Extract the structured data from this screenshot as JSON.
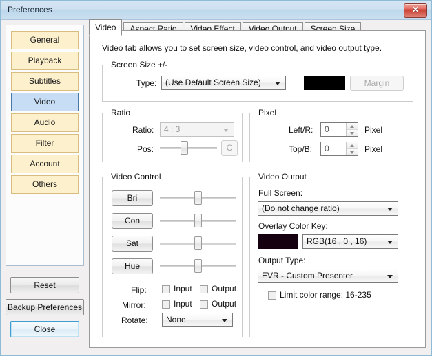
{
  "window": {
    "title": "Preferences",
    "close_label": "✕"
  },
  "sidebar": {
    "items": [
      {
        "label": "General",
        "selected": false
      },
      {
        "label": "Playback",
        "selected": false
      },
      {
        "label": "Subtitles",
        "selected": false
      },
      {
        "label": "Video",
        "selected": true
      },
      {
        "label": "Audio",
        "selected": false
      },
      {
        "label": "Filter",
        "selected": false
      },
      {
        "label": "Account",
        "selected": false
      },
      {
        "label": "Others",
        "selected": false
      }
    ],
    "actions": [
      {
        "label": "Reset"
      },
      {
        "label": "Backup Preferences"
      },
      {
        "label": "Close"
      }
    ]
  },
  "tabs": [
    {
      "label": "Video",
      "active": true
    },
    {
      "label": "Aspect Ratio",
      "active": false
    },
    {
      "label": "Video Effect",
      "active": false
    },
    {
      "label": "Video Output",
      "active": false
    },
    {
      "label": "Screen Size",
      "active": false
    }
  ],
  "main": {
    "description": "Video tab allows you to set screen size, video control, and video output type.",
    "screen_size": {
      "legend": "Screen Size +/-",
      "type_label": "Type:",
      "type_value": "(Use Default Screen Size)",
      "color_swatch": "#000000",
      "margin_button": "Margin"
    },
    "ratio": {
      "legend": "Ratio",
      "ratio_label": "Ratio:",
      "ratio_value": "4 : 3",
      "pos_label": "Pos:",
      "pos_percent": 42,
      "center_button": "C"
    },
    "pixel": {
      "legend": "Pixel",
      "left_right_label": "Left/R:",
      "left_right_value": "0",
      "left_right_unit": "Pixel",
      "top_bottom_label": "Top/B:",
      "top_bottom_value": "0",
      "top_bottom_unit": "Pixel"
    },
    "video_control": {
      "legend": "Video Control",
      "controls": [
        {
          "label": "Bri",
          "percent": 50
        },
        {
          "label": "Con",
          "percent": 50
        },
        {
          "label": "Sat",
          "percent": 50
        },
        {
          "label": "Hue",
          "percent": 50
        }
      ],
      "flip_label": "Flip:",
      "flip_input": "Input",
      "flip_output": "Output",
      "mirror_label": "Mirror:",
      "mirror_input": "Input",
      "mirror_output": "Output",
      "rotate_label": "Rotate:",
      "rotate_value": "None"
    },
    "video_output": {
      "legend": "Video Output",
      "full_screen_label": "Full Screen:",
      "full_screen_value": "(Do not change ratio)",
      "overlay_label": "Overlay Color Key:",
      "overlay_swatch": "#150010",
      "overlay_value": "RGB(16 , 0 , 16)",
      "output_type_label": "Output Type:",
      "output_type_value": "EVR - Custom Presenter",
      "limit_range_label": "Limit color range: 16-235"
    }
  }
}
